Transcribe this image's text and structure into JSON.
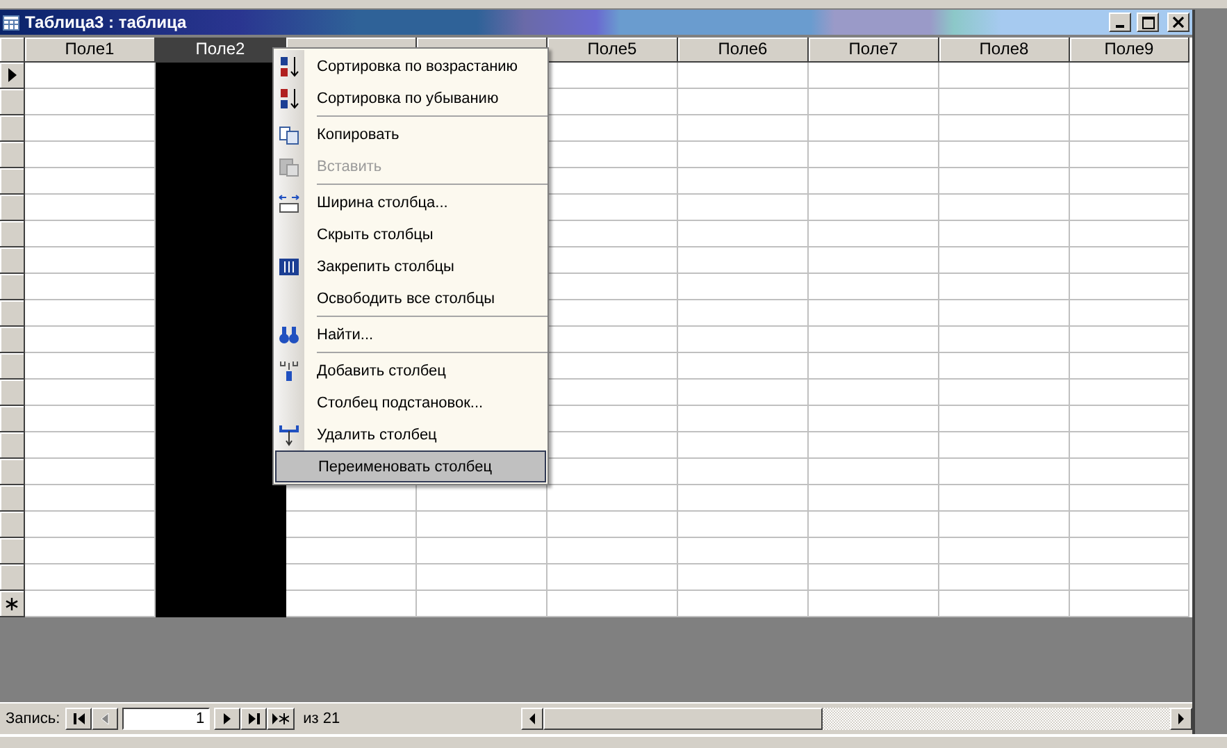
{
  "window": {
    "title": "Таблица3 : таблица"
  },
  "table": {
    "columns": [
      {
        "label": "Поле1",
        "selected": false
      },
      {
        "label": "Поле2",
        "selected": true
      },
      {
        "selected": false
      },
      {
        "selected": false
      },
      {
        "label": "Поле5",
        "selected": false
      },
      {
        "label": "Поле6",
        "selected": false
      },
      {
        "label": "Поле7",
        "selected": false
      },
      {
        "label": "Поле8",
        "selected": false
      },
      {
        "label": "Поле9",
        "selected": false
      }
    ],
    "rows": [
      {
        "kind": "current"
      },
      {
        "kind": "plain"
      },
      {
        "kind": "plain"
      },
      {
        "kind": "plain"
      },
      {
        "kind": "plain"
      },
      {
        "kind": "plain"
      },
      {
        "kind": "plain"
      },
      {
        "kind": "plain"
      },
      {
        "kind": "plain"
      },
      {
        "kind": "plain"
      },
      {
        "kind": "plain"
      },
      {
        "kind": "plain"
      },
      {
        "kind": "plain"
      },
      {
        "kind": "plain"
      },
      {
        "kind": "plain"
      },
      {
        "kind": "plain"
      },
      {
        "kind": "plain"
      },
      {
        "kind": "plain"
      },
      {
        "kind": "plain"
      },
      {
        "kind": "plain"
      },
      {
        "kind": "new"
      }
    ]
  },
  "context_menu": {
    "items": [
      {
        "kind": "item",
        "label": "Сортировка по возрастанию",
        "disabled": false,
        "selected": false
      },
      {
        "kind": "item",
        "label": "Сортировка по убыванию",
        "disabled": false,
        "selected": false
      },
      {
        "kind": "separator"
      },
      {
        "kind": "item",
        "label": "Копировать",
        "disabled": false,
        "selected": false
      },
      {
        "kind": "item",
        "label": "Вставить",
        "disabled": true,
        "selected": false
      },
      {
        "kind": "separator"
      },
      {
        "kind": "item",
        "label": "Ширина столбца...",
        "disabled": false,
        "selected": false
      },
      {
        "kind": "item",
        "label": "Скрыть столбцы",
        "disabled": false,
        "selected": false
      },
      {
        "kind": "item",
        "label": "Закрепить столбцы",
        "disabled": false,
        "selected": false
      },
      {
        "kind": "item",
        "label": "Освободить все столбцы",
        "disabled": false,
        "selected": false
      },
      {
        "kind": "separator"
      },
      {
        "kind": "item",
        "label": "Найти...",
        "disabled": false,
        "selected": false
      },
      {
        "kind": "separator"
      },
      {
        "kind": "item",
        "label": "Добавить столбец",
        "disabled": false,
        "selected": false
      },
      {
        "kind": "item",
        "label": "Столбец  подстановок...",
        "disabled": false,
        "selected": false
      },
      {
        "kind": "item",
        "label": "Удалить столбец",
        "disabled": false,
        "selected": false
      },
      {
        "kind": "item",
        "label": "Переименовать столбец",
        "disabled": false,
        "selected": true
      }
    ]
  },
  "navigation": {
    "label": "Запись:",
    "record": "1",
    "total": "из 21",
    "first_disabled": false,
    "previous_disabled": true
  }
}
